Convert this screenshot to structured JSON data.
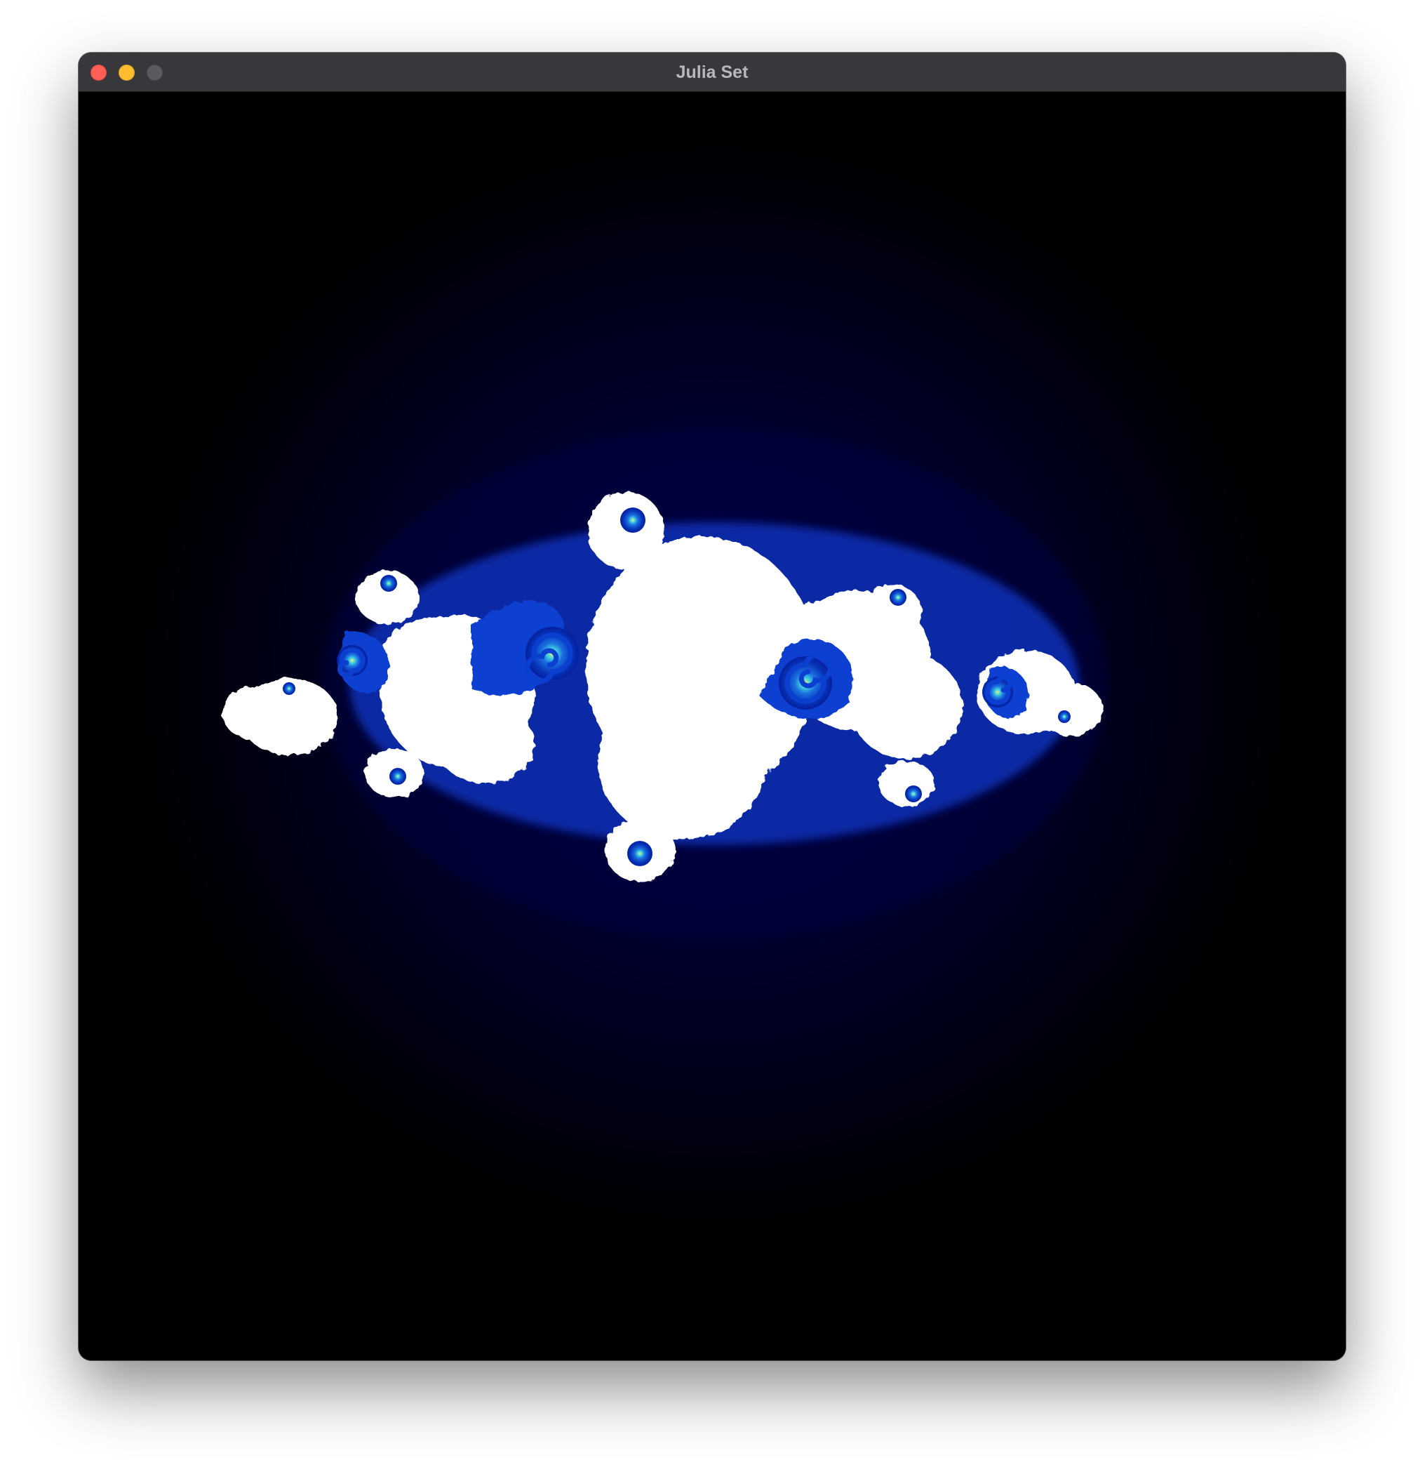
{
  "window": {
    "title": "Julia Set",
    "controls": {
      "close_icon": "close-icon",
      "minimize_icon": "minimize-icon",
      "zoom_icon": "zoom-icon"
    }
  },
  "fractal": {
    "type": "julia-set",
    "colors": {
      "background": "#000000",
      "halo": "#00003a",
      "interior": "#ffffff",
      "spiral_blue": "#0a3fd0",
      "spiral_deep": "#052a9e",
      "spiral_cyan": "#36c8e6",
      "spiral_yellow": "#e8f060"
    }
  }
}
